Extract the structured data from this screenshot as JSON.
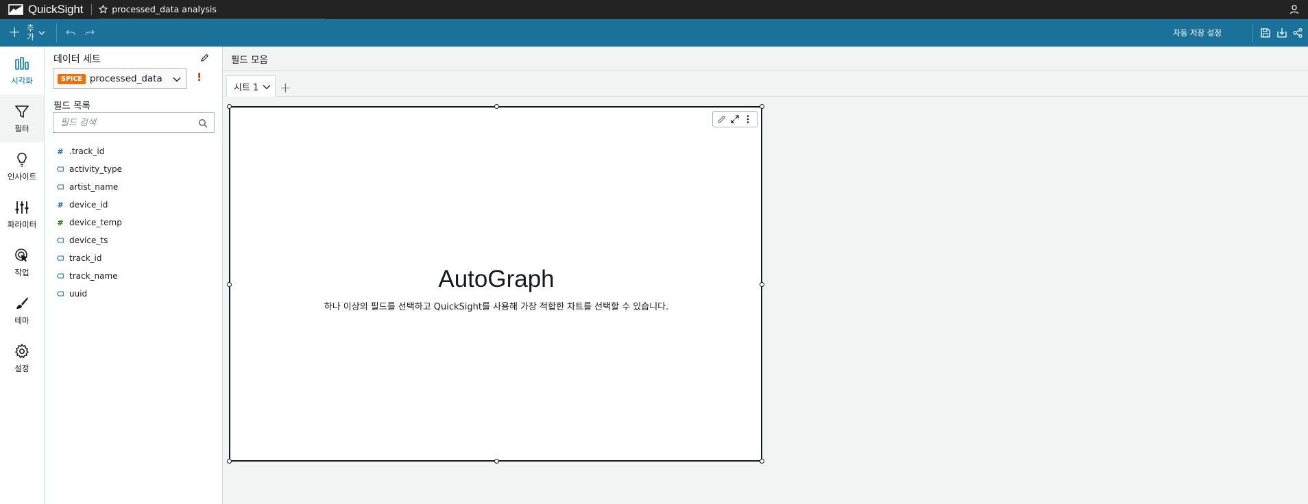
{
  "app": {
    "brand": "QuickSight",
    "analysis_title": "processed_data analysis"
  },
  "toolbar": {
    "add_label": "추가",
    "autosave_label": "자동 저장 설정"
  },
  "rail": [
    {
      "label": "시각화",
      "icon": "bar-chart-icon"
    },
    {
      "label": "필터",
      "icon": "filter-icon"
    },
    {
      "label": "인사이트",
      "icon": "lightbulb-icon"
    },
    {
      "label": "파라미터",
      "icon": "sliders-icon"
    },
    {
      "label": "작업",
      "icon": "cursor-click-icon"
    },
    {
      "label": "테마",
      "icon": "brush-icon"
    },
    {
      "label": "설정",
      "icon": "gear-icon"
    }
  ],
  "datapanel": {
    "title": "데이터 세트",
    "dataset_badge": "SPICE",
    "dataset_name": "processed_data",
    "warning": "!",
    "field_list_title": "필드 목록",
    "search_placeholder": "필드 검색",
    "fields": [
      {
        "name": ".track_id",
        "type": "number"
      },
      {
        "name": "activity_type",
        "type": "string"
      },
      {
        "name": "artist_name",
        "type": "string"
      },
      {
        "name": "device_id",
        "type": "number"
      },
      {
        "name": "device_temp",
        "type": "number-decimal"
      },
      {
        "name": "device_ts",
        "type": "string"
      },
      {
        "name": "track_id",
        "type": "string"
      },
      {
        "name": "track_name",
        "type": "string"
      },
      {
        "name": "uuid",
        "type": "string"
      }
    ]
  },
  "main": {
    "field_wells_label": "필드 모음",
    "sheet_tab": "시트 1",
    "add_sheet": "+",
    "visual": {
      "title": "AutoGraph",
      "subtitle": "하나 이상의 필드를 선택하고 QuickSight를 사용해 가장 적합한 차트를 선택할 수 있습니다."
    }
  },
  "colors": {
    "toolbar_blue": "#1a7199",
    "topbar_black": "#232323",
    "spice_orange": "#ec7211",
    "active_blue": "#0073bb"
  }
}
